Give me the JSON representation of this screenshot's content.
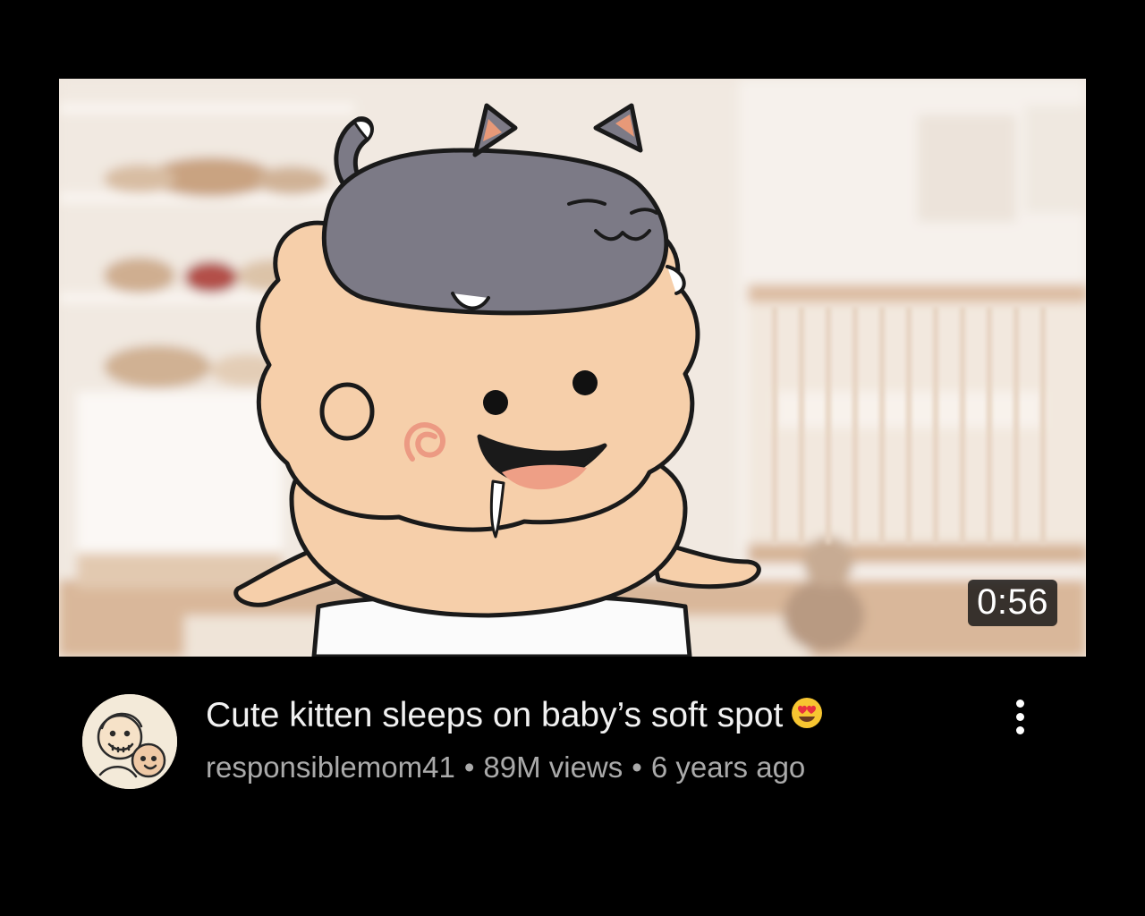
{
  "video": {
    "duration": "0:56",
    "title": "Cute kitten sleeps on baby’s soft spot",
    "title_emoji": "heart-eyes-emoji",
    "channel": "responsiblemom41",
    "views": "89M views",
    "age": "6 years ago",
    "separator": "•"
  },
  "icons": {
    "menu": "more-vert-icon",
    "avatar": "channel-avatar"
  },
  "colors": {
    "background": "#000000",
    "title_text": "#f1f1f1",
    "meta_text": "#aaaaaa",
    "duration_badge_bg": "#141414",
    "duration_text": "#ffffff"
  }
}
